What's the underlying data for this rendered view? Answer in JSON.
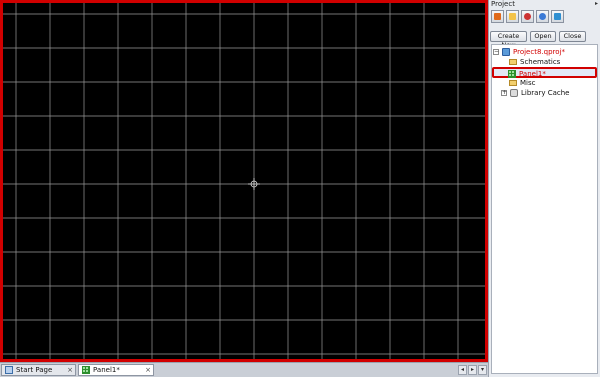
{
  "panel": {
    "title": "Project",
    "pin_glyph": "▸",
    "toolbar_icons": [
      {
        "name": "new-schematic-icon",
        "color": "#e06a1c"
      },
      {
        "name": "document-icon",
        "color": "#f3c34a"
      },
      {
        "name": "component-icon",
        "color": "#cc3333"
      },
      {
        "name": "chat-icon",
        "color": "#3b7ad6"
      },
      {
        "name": "computer-icon",
        "color": "#2f8fd1"
      }
    ],
    "buttons": {
      "create_new": "Create New",
      "open": "Open",
      "close": "Close"
    },
    "tree": {
      "project": "Project8.qproj*",
      "schematics": "Schematics",
      "panel": "Panel1*",
      "misc": "Misc",
      "library_cache": "Library Cache",
      "collapse_glyph": "−",
      "expand_glyph": "+"
    }
  },
  "tabs": [
    {
      "label": "Start Page",
      "icon": "page-icon",
      "active": false,
      "close": "×"
    },
    {
      "label": "Panel1*",
      "icon": "grid-icon",
      "active": true,
      "close": "×"
    }
  ],
  "nav": {
    "prev": "◂",
    "next": "▸",
    "menu": "▾"
  },
  "canvas": {
    "background": "#000000",
    "grid_color": "#9a9a9a",
    "highlight_color": "#d10000",
    "cursor": "crosshair-icon"
  }
}
